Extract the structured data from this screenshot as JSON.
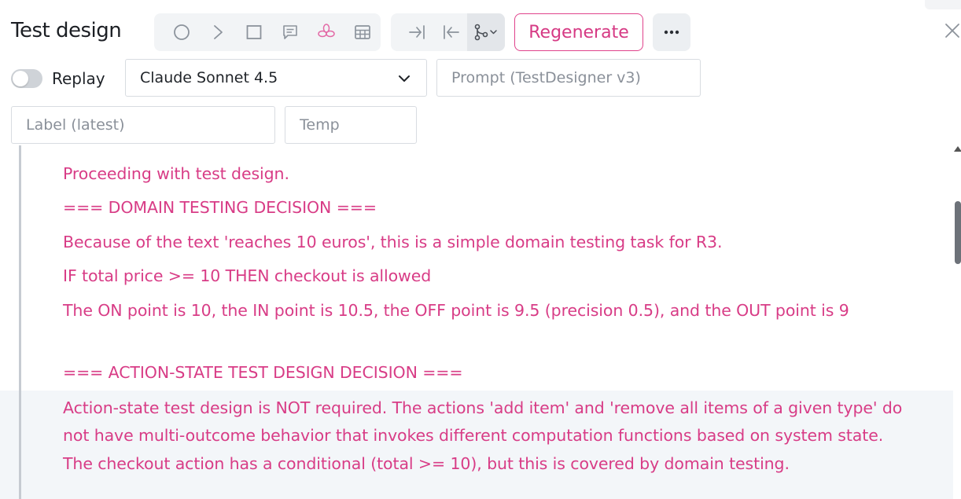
{
  "header": {
    "title": "Test design",
    "regenerate_label": "Regenerate",
    "more_label": "•••"
  },
  "toolbar": {
    "group1": [
      "circle-icon",
      "chevron-right-icon",
      "square-icon",
      "comment-icon",
      "flower-icon",
      "table-icon"
    ],
    "group2": [
      "arrow-to-right-icon",
      "arrow-to-left-icon",
      "branch-icon"
    ]
  },
  "controls": {
    "replay_label": "Replay",
    "replay_on": false,
    "model_selected": "Claude Sonnet 4.5",
    "prompt_placeholder": "Prompt (TestDesigner v3)",
    "label_placeholder": "Label (latest)",
    "temp_placeholder": "Temp"
  },
  "output": {
    "lines": [
      "Proceeding with test design.",
      "=== DOMAIN TESTING DECISION ===",
      "Because of the text 'reaches 10 euros', this is a simple domain testing task for R3.",
      "IF total price >= 10 THEN checkout is allowed",
      "The ON point is 10, the IN point is 10.5, the OFF point is 9.5 (precision 0.5), and the OUT point is 9",
      "=== ACTION-STATE TEST DESIGN DECISION ===",
      "Action-state test design is NOT required. The actions 'add item' and 'remove all items of a given type' do",
      "not have multi-outcome behavior that invokes different computation functions based on system state.",
      "The checkout action has a conditional (total >= 10), but this is covered by domain testing."
    ]
  },
  "colors": {
    "accent": "#d83c86",
    "text": "#1f2328",
    "border": "#d8dce1"
  }
}
